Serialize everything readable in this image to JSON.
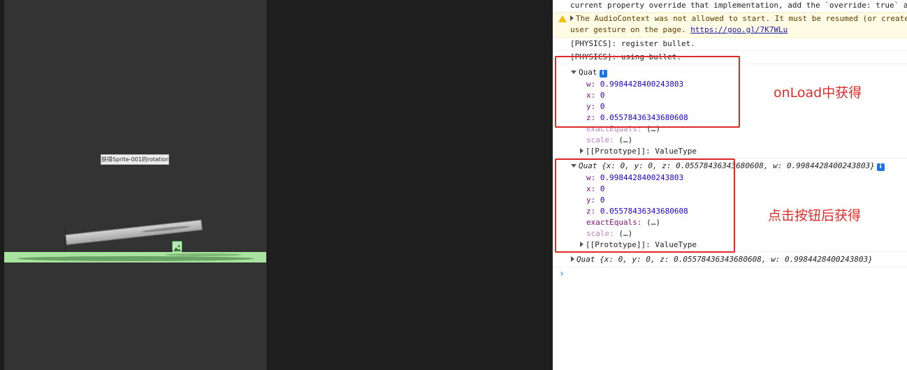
{
  "game": {
    "button_label": "获得Sprite-001的rotation"
  },
  "console": {
    "lines": {
      "override_text": "current property override that implementation, add the `override: true` a",
      "audio_warning_1": "The AudioContext was not allowed to start. It must be resumed (or create",
      "audio_warning_2_prefix": "user gesture on the page. ",
      "audio_warning_link": "https://goo.gl/7K7WLu",
      "physics_register": "[PHYSICS]: register bullet.",
      "physics_using": "[PHYSICS]: using bullet."
    },
    "quat1": {
      "label": "Quat",
      "info_badge": "i",
      "w_key": "w:",
      "w": "0.9984428400243803",
      "x_key": "x:",
      "x": "0",
      "y_key": "y:",
      "y": "0",
      "z_key": "z:",
      "z": "0.05578436343680608",
      "exactEquals": "exactEquals:",
      "exactEquals_val": "(…)",
      "scale": "scale:",
      "scale_val": "(…)",
      "proto": "[[Prototype]]: ValueType"
    },
    "quat2": {
      "summary": "Quat {x: 0, y: 0, z: 0.05578436343680608, w: 0.9984428400243803}",
      "info_badge": "i",
      "w_key": "w:",
      "w": "0.9984428400243803",
      "x_key": "x:",
      "x": "0",
      "y_key": "y:",
      "y": "0",
      "z_key": "z:",
      "z": "0.05578436343680608",
      "exactEquals": "exactEquals:",
      "exactEquals_val": "(…)",
      "scale": "scale:",
      "scale_val": "(…)",
      "proto": "[[Prototype]]: ValueType"
    },
    "quat3": {
      "summary": "Quat {x: 0, y: 0, z: 0.05578436343680608, w: 0.9984428400243803}"
    },
    "prompt": "›"
  },
  "annotations": {
    "onload": "onLoad中获得",
    "after_click": "点击按钮后获得"
  },
  "colors": {
    "annotation_red": "#e02a2a",
    "ground_green": "#a8e4a0",
    "console_number": "#1c00cf",
    "console_key": "#881280"
  }
}
